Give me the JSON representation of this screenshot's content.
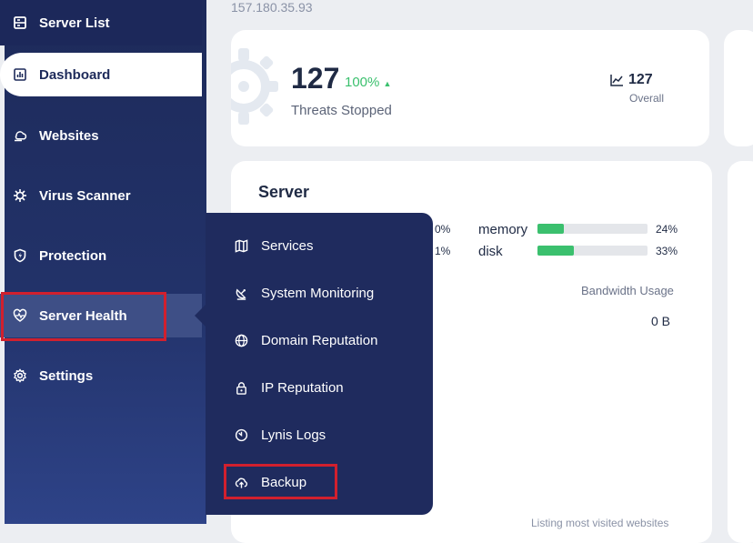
{
  "sidebar": {
    "items": [
      {
        "label": "Server List",
        "icon": "server-list-icon"
      },
      {
        "label": "Dashboard",
        "icon": "dashboard-icon"
      },
      {
        "label": "Websites",
        "icon": "websites-icon"
      },
      {
        "label": "Virus Scanner",
        "icon": "virus-scanner-icon"
      },
      {
        "label": "Protection",
        "icon": "shield-icon"
      },
      {
        "label": "Server Health",
        "icon": "heart-pulse-icon"
      },
      {
        "label": "Settings",
        "icon": "gear-icon"
      }
    ]
  },
  "header": {
    "ip": "157.180.35.93"
  },
  "threats_card": {
    "value": "127",
    "change": "100%",
    "label": "Threats Stopped",
    "overall_value": "127",
    "overall_label": "Overall"
  },
  "server_card": {
    "title": "Server",
    "left_pcts": [
      "0%",
      "1%"
    ],
    "resources": [
      {
        "label": "memory",
        "percent": 24,
        "percent_text": "24%"
      },
      {
        "label": "disk",
        "percent": 33,
        "percent_text": "33%"
      }
    ],
    "bandwidth_label": "Bandwidth Usage",
    "bandwidth_value": "0 B",
    "listing_label": "Listing most visited websites"
  },
  "submenu": {
    "items": [
      {
        "label": "Services",
        "icon": "map-icon"
      },
      {
        "label": "System Monitoring",
        "icon": "satellite-dish-icon"
      },
      {
        "label": "Domain Reputation",
        "icon": "globe-icon"
      },
      {
        "label": "IP Reputation",
        "icon": "lock-icon"
      },
      {
        "label": "Lynis Logs",
        "icon": "clock-icon"
      },
      {
        "label": "Backup",
        "icon": "cloud-upload-icon"
      }
    ]
  },
  "colors": {
    "sidebar": "#1d2a5a",
    "accent_green": "#3bc06e",
    "highlight_red": "#d1202e"
  }
}
